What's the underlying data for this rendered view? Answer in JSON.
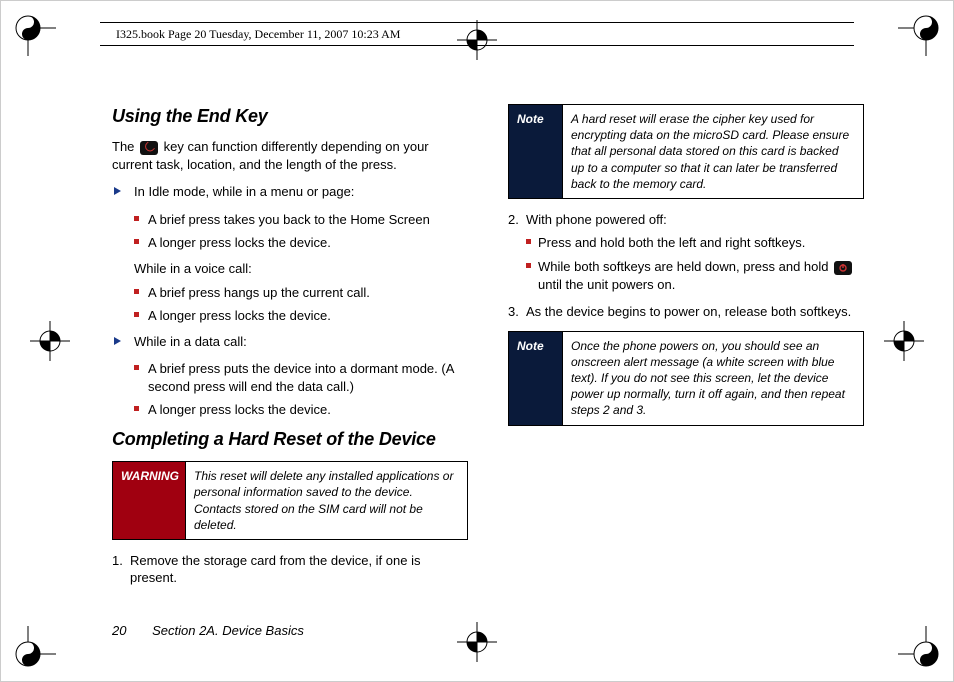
{
  "header": {
    "book_path": "I325.book  Page 20  Tuesday, December 11, 2007  10:23 AM"
  },
  "left": {
    "h1": "Using the End Key",
    "lead_before": "The ",
    "lead_after": " key can function differently depending on your current task, location, and the length of the press.",
    "arrow1": "In Idle mode, while in a menu or page:",
    "sq1a": "A brief press takes you back to the Home Screen",
    "sq1b": "A longer press locks the device.",
    "midline": "While in a voice call:",
    "sq2a": "A brief press hangs up the current call.",
    "sq2b": "A longer press locks the device.",
    "arrow3": "While in a data call:",
    "sq3a": "A brief press puts the device into a dormant mode. (A second press will end the data call.)",
    "sq3b": "A longer press locks the device.",
    "h2": "Completing a Hard Reset of the Device",
    "warning_label": "WARNING",
    "warning_body": "This reset will delete any installed applications or personal information saved to the device. Contacts stored on the SIM card will not be deleted."
  },
  "right": {
    "step1": "Remove the storage card from the device, if one is present.",
    "note1_label": "Note",
    "note1_body": "A hard reset will erase the cipher key used for encrypting data on the microSD card. Please ensure that all personal data stored on this card is backed up to a computer so that it can later be transferred back to the memory card.",
    "step2": "With phone powered off:",
    "step2a": "Press and hold both the left and right softkeys.",
    "step2b_before": "While both softkeys are held down, press and hold ",
    "step2b_after": " until the unit powers on.",
    "step3": "As the device begins to power on, release both softkeys.",
    "note2_label": "Note",
    "note2_body": "Once the phone powers on, you should see an onscreen alert message (a white screen with blue text). If you do not see this screen, let the device power up normally, turn it off again, and then repeat steps 2 and 3."
  },
  "footer": {
    "page": "20",
    "section": "Section 2A. Device Basics"
  }
}
